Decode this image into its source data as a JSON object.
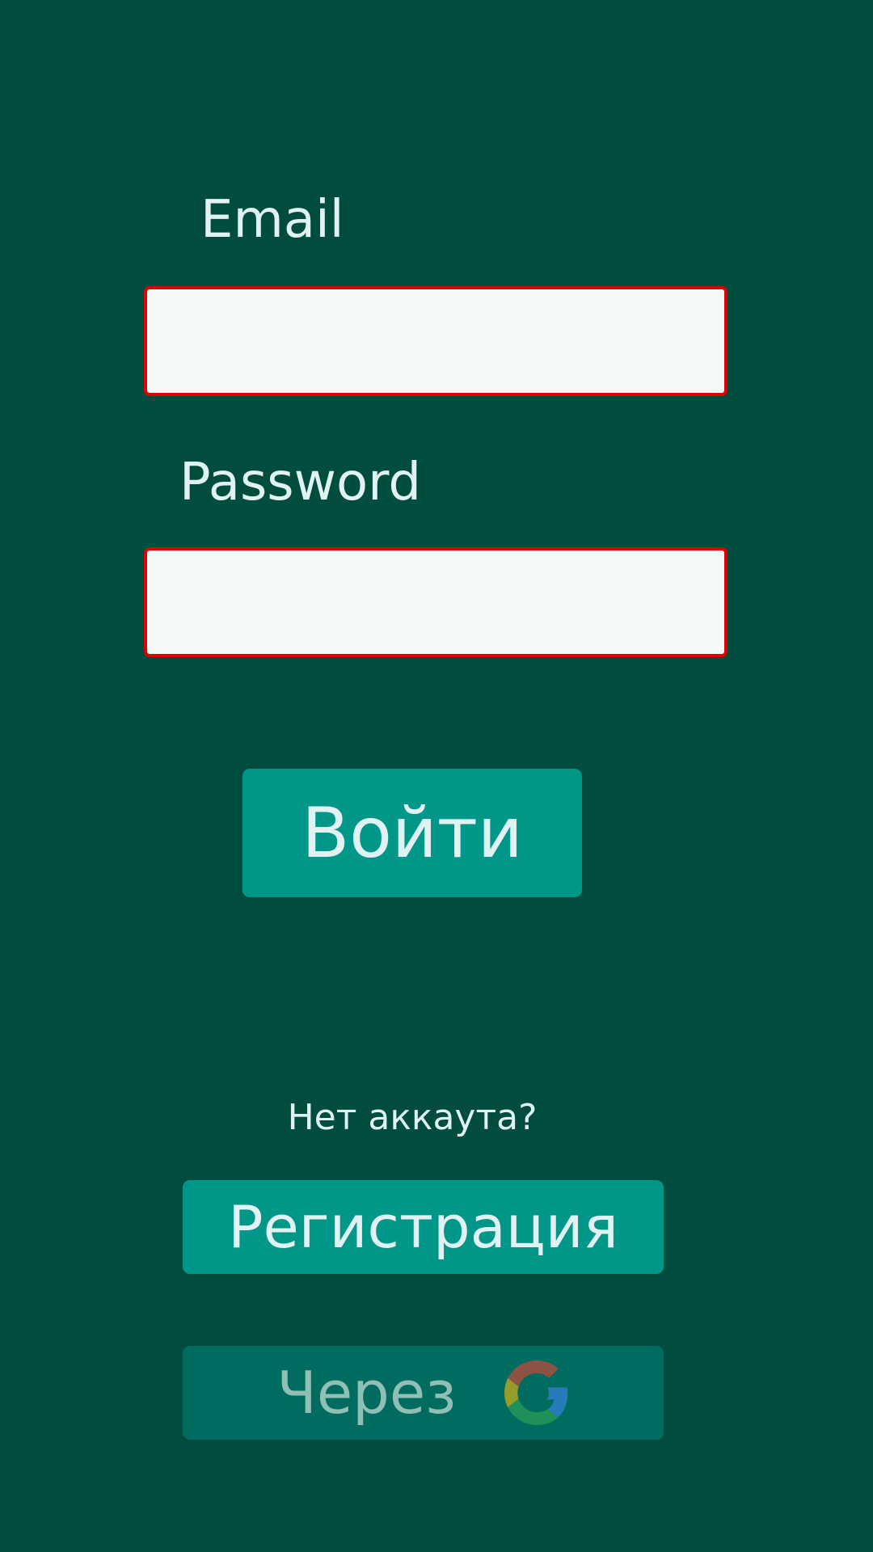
{
  "login_form": {
    "email_label": "Email",
    "email_value": "",
    "email_placeholder": "",
    "password_label": "Password",
    "password_value": "",
    "password_placeholder": "",
    "login_button_label": "Войти"
  },
  "signup": {
    "no_account_text": "Нет аккаута?",
    "register_button_label": "Регистрация",
    "google_button_label": "Через",
    "google_icon": "google-icon"
  },
  "colors": {
    "background": "#004d40",
    "button": "#009688",
    "button_disabled": "#006c5f",
    "input_error_border": "#e00000",
    "text": "#e0f2f1"
  }
}
